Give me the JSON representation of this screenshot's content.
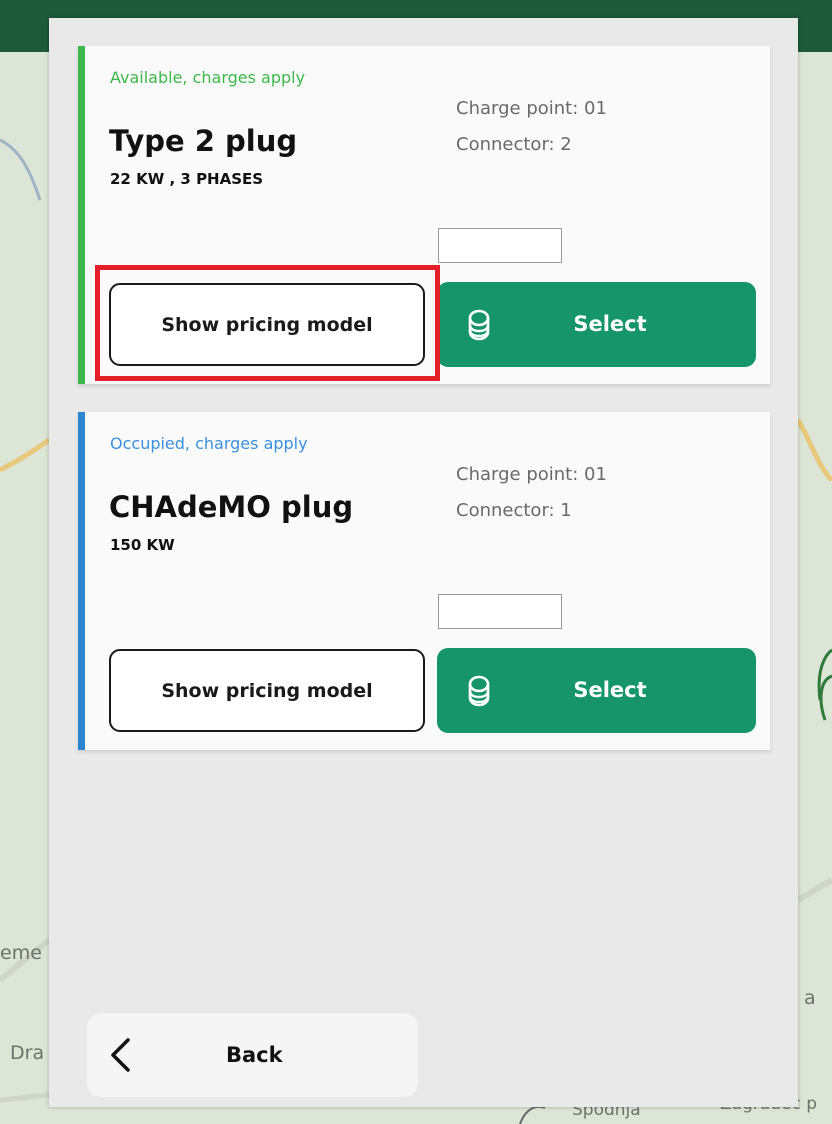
{
  "map": {
    "labels": [
      "eme",
      "Dra",
      "a",
      "Spodnja",
      "Zagradec p"
    ]
  },
  "connectors": [
    {
      "status": "Available, charges apply",
      "status_color": "#3db84a",
      "plug_name": "Type 2 plug",
      "power": "22 KW , 3 PHASES",
      "charge_point": "Charge point: 01",
      "connector": "Connector: 2",
      "pricing_label": "Show pricing model",
      "select_label": "Select",
      "select_icon": "coins-icon",
      "highlighted": true
    },
    {
      "status": "Occupied, charges apply",
      "status_color": "#3b8fdd",
      "plug_name": "CHAdeMO plug",
      "power": "150 KW",
      "charge_point": "Charge point: 01",
      "connector": "Connector: 1",
      "pricing_label": "Show pricing model",
      "select_label": "Select",
      "select_icon": "coins-icon",
      "highlighted": false
    }
  ],
  "footer": {
    "back_label": "Back",
    "back_icon": "chevron-left-icon"
  },
  "colors": {
    "accent": "#16956a",
    "highlight": "#e3202a",
    "header": "#1d5a3a"
  }
}
